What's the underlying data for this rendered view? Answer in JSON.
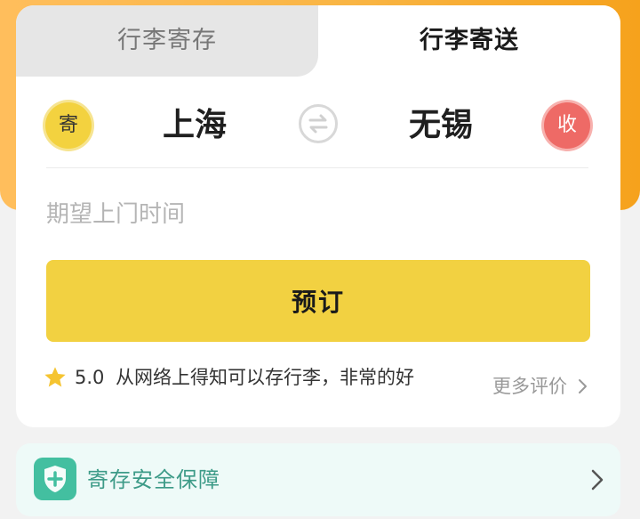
{
  "tabs": [
    {
      "label": "行李寄存",
      "active": false
    },
    {
      "label": "行李寄送",
      "active": true
    }
  ],
  "route": {
    "send_badge": "寄",
    "from_city": "上海",
    "to_city": "无锡",
    "receive_badge": "收"
  },
  "form": {
    "time_placeholder": "期望上门时间",
    "book_label": "预订"
  },
  "review": {
    "score": "5.0",
    "text": "从网络上得知可以存行李，非常的好",
    "more_label": "更多评价"
  },
  "safety": {
    "label": "寄存安全保障"
  },
  "colors": {
    "accent_yellow": "#f2d141",
    "banner_orange": "#f9b544",
    "receive_red": "#ee6a66",
    "safety_green": "#3d9b88"
  },
  "icons": {
    "swap": "swap-arrows-icon",
    "star": "star-icon",
    "shield": "shield-plus-icon",
    "chevron": "chevron-right-icon"
  }
}
